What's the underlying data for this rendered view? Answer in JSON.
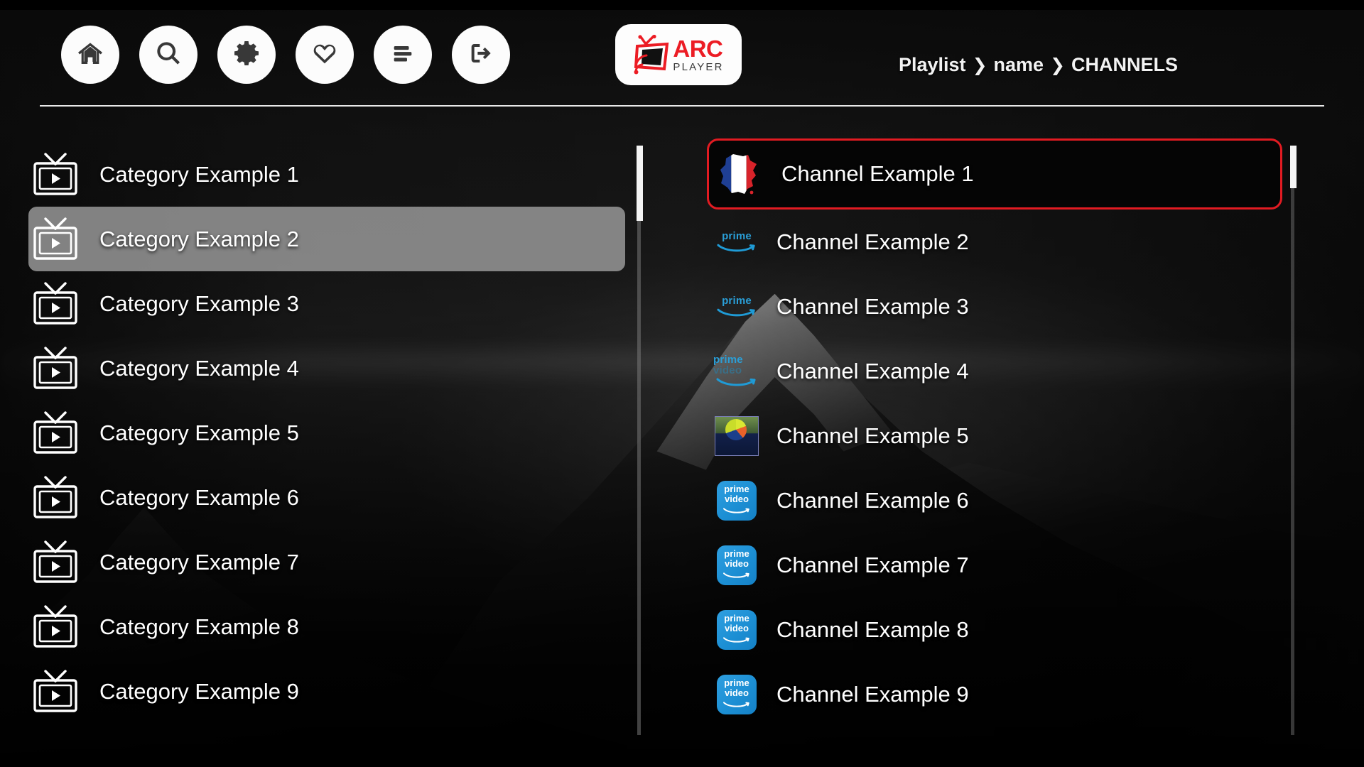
{
  "app": {
    "logo": {
      "mark": "tv-antenna-wifi-icon",
      "name": "ARC",
      "subtitle": "PLAYER",
      "name_color": "#ec1c24",
      "subtitle_color": "#3b3b3b"
    }
  },
  "header": {
    "nav_items": [
      {
        "icon": "home-icon",
        "name": "home"
      },
      {
        "icon": "search-icon",
        "name": "search"
      },
      {
        "icon": "gear-icon",
        "name": "settings"
      },
      {
        "icon": "heart-icon",
        "name": "favorites"
      },
      {
        "icon": "hamburger-menu-icon",
        "name": "menu"
      },
      {
        "icon": "logout-icon",
        "name": "logout"
      }
    ],
    "breadcrumb": {
      "separator": "❯",
      "items": [
        "Playlist",
        "name",
        "CHANNELS"
      ]
    }
  },
  "categories": {
    "selected_index": 1,
    "items": [
      {
        "label": "Category Example 1",
        "icon": "tv-play-icon"
      },
      {
        "label": "Category Example 2",
        "icon": "tv-play-icon"
      },
      {
        "label": "Category Example 3",
        "icon": "tv-play-icon"
      },
      {
        "label": "Category Example 4",
        "icon": "tv-play-icon"
      },
      {
        "label": "Category Example 5",
        "icon": "tv-play-icon"
      },
      {
        "label": "Category Example 6",
        "icon": "tv-play-icon"
      },
      {
        "label": "Category Example 7",
        "icon": "tv-play-icon"
      },
      {
        "label": "Category Example 8",
        "icon": "tv-play-icon"
      },
      {
        "label": "Category Example 9",
        "icon": "tv-play-icon"
      }
    ]
  },
  "channels": {
    "focused_index": 0,
    "focus_color": "#e21b22",
    "items": [
      {
        "label": "Channel Example 1",
        "logo_type": "france-flag-map",
        "logo_name": "france-flag-icon"
      },
      {
        "label": "Channel Example 2",
        "logo_type": "prime-word",
        "logo_name": "amazon-prime-logo",
        "logo_text": "prime"
      },
      {
        "label": "Channel Example 3",
        "logo_type": "prime-word",
        "logo_name": "amazon-prime-logo",
        "logo_text": "prime"
      },
      {
        "label": "Channel Example 4",
        "logo_type": "prime-video-word",
        "logo_name": "prime-video-logo",
        "logo_text": "prime",
        "logo_text2": "video"
      },
      {
        "label": "Channel Example 5",
        "logo_type": "thumbnail",
        "logo_name": "soccer-thumbnail-image"
      },
      {
        "label": "Channel Example 6",
        "logo_type": "prime-tile",
        "logo_name": "prime-video-app-icon",
        "logo_text": "prime",
        "logo_text2": "video"
      },
      {
        "label": "Channel Example 7",
        "logo_type": "prime-tile",
        "logo_name": "prime-video-app-icon",
        "logo_text": "prime",
        "logo_text2": "video"
      },
      {
        "label": "Channel Example 8",
        "logo_type": "prime-tile",
        "logo_name": "prime-video-app-icon",
        "logo_text": "prime",
        "logo_text2": "video"
      },
      {
        "label": "Channel Example 9",
        "logo_type": "prime-tile",
        "logo_name": "prime-video-app-icon",
        "logo_text": "prime",
        "logo_text2": "video"
      }
    ]
  },
  "scrollbars": {
    "categories": {
      "thumb_top_pct": 0,
      "thumb_size_pct": 13
    },
    "channels": {
      "thumb_top_pct": 0,
      "thumb_size_pct": 7
    }
  },
  "theme": {
    "background": "#000000",
    "accent": "#e21b22",
    "text": "#ffffff",
    "selected_category_bg": "rgba(160,160,160,0.80)"
  }
}
